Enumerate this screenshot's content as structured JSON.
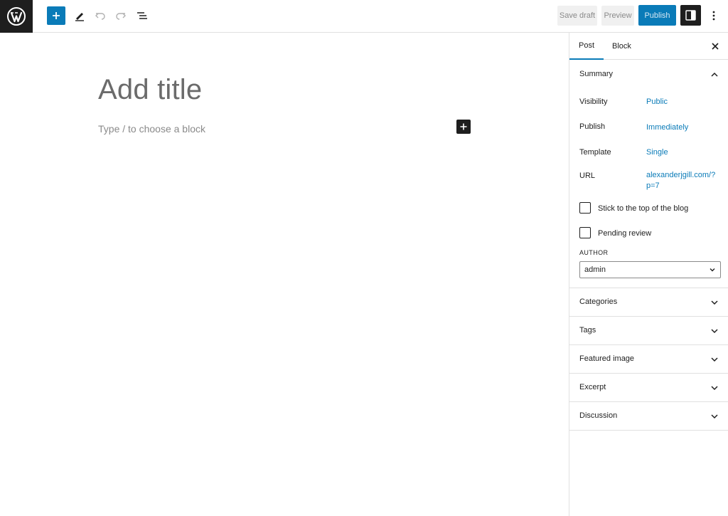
{
  "toolbar": {
    "save_draft": "Save draft",
    "preview": "Preview",
    "publish": "Publish",
    "accent": "#0a7bb8"
  },
  "editor": {
    "title_placeholder": "Add title",
    "block_placeholder": "Type / to choose a block"
  },
  "sidebar": {
    "tabs": [
      {
        "label": "Post"
      },
      {
        "label": "Block"
      }
    ],
    "summary": {
      "title": "Summary",
      "rows": [
        {
          "label": "Visibility",
          "value": "Public"
        },
        {
          "label": "Publish",
          "value": "Immediately"
        },
        {
          "label": "Template",
          "value": "Single"
        },
        {
          "label": "URL",
          "value": "alexanderjgill.com/?p=7"
        }
      ],
      "checkboxes": [
        {
          "label": "Stick to the top of the blog",
          "checked": false
        },
        {
          "label": "Pending review",
          "checked": false
        }
      ],
      "author_label": "AUTHOR",
      "author_value": "admin"
    },
    "panels": [
      {
        "label": "Categories"
      },
      {
        "label": "Tags"
      },
      {
        "label": "Featured image"
      },
      {
        "label": "Excerpt"
      },
      {
        "label": "Discussion"
      }
    ]
  }
}
